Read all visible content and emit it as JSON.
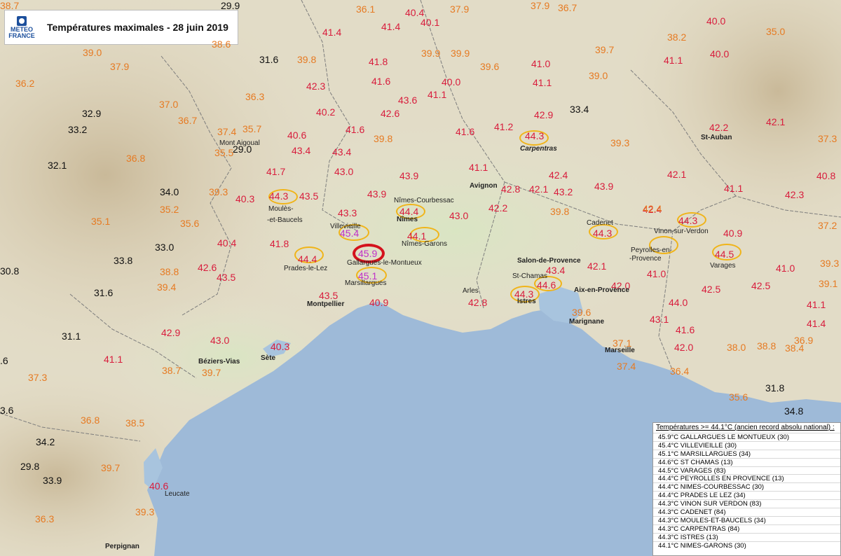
{
  "title": "Températures maximales - 28 juin 2019",
  "logo": {
    "line1": "METEO",
    "line2": "FRANCE"
  },
  "colors": {
    "black": "#111111",
    "orange": "#e67a22",
    "red": "#d81c3c",
    "magenta": "#c030c8",
    "sea": "#9ebad8",
    "ring_yellow": "#f0b418",
    "ring_red": "#d4121c"
  },
  "temperatures": [
    {
      "v": "38.7",
      "c": "orange"
    },
    {
      "v": "29.9",
      "c": "black"
    },
    {
      "v": "36.1",
      "c": "orange"
    },
    {
      "v": "40.4",
      "c": "red"
    },
    {
      "v": "37.9",
      "c": "orange"
    },
    {
      "v": "37.9",
      "c": "orange"
    },
    {
      "v": "36.7",
      "c": "orange"
    },
    {
      "v": "38.2",
      "c": "orange"
    },
    {
      "v": "40.0",
      "c": "red"
    },
    {
      "v": "35.0",
      "c": "orange"
    },
    {
      "v": "41.4",
      "c": "red"
    },
    {
      "v": "41.4",
      "c": "red"
    },
    {
      "v": "40.1",
      "c": "red"
    },
    {
      "v": "38.6",
      "c": "orange"
    },
    {
      "v": "39.0",
      "c": "orange"
    },
    {
      "v": "37.9",
      "c": "orange"
    },
    {
      "v": "31.6",
      "c": "black"
    },
    {
      "v": "39.8",
      "c": "orange"
    },
    {
      "v": "41.8",
      "c": "red"
    },
    {
      "v": "39.9",
      "c": "orange"
    },
    {
      "v": "39.9",
      "c": "orange"
    },
    {
      "v": "39.6",
      "c": "orange"
    },
    {
      "v": "41.0",
      "c": "red"
    },
    {
      "v": "39.7",
      "c": "orange"
    },
    {
      "v": "41.1",
      "c": "red"
    },
    {
      "v": "40.0",
      "c": "red"
    },
    {
      "v": "36.2",
      "c": "orange"
    },
    {
      "v": "42.3",
      "c": "red"
    },
    {
      "v": "41.6",
      "c": "red"
    },
    {
      "v": "40.0",
      "c": "red"
    },
    {
      "v": "39.0",
      "c": "orange"
    },
    {
      "v": "41.1",
      "c": "red"
    },
    {
      "v": "36.3",
      "c": "orange"
    },
    {
      "v": "43.6",
      "c": "red"
    },
    {
      "v": "41.1",
      "c": "red"
    },
    {
      "v": "37.0",
      "c": "orange"
    },
    {
      "v": "32.9",
      "c": "black"
    },
    {
      "v": "40.2",
      "c": "red"
    },
    {
      "v": "42.6",
      "c": "red"
    },
    {
      "v": "42.9",
      "c": "red"
    },
    {
      "v": "33.4",
      "c": "black"
    },
    {
      "v": "36.7",
      "c": "orange"
    },
    {
      "v": "33.2",
      "c": "black"
    },
    {
      "v": "37.4",
      "c": "orange"
    },
    {
      "v": "35.7",
      "c": "orange"
    },
    {
      "v": "40.6",
      "c": "red"
    },
    {
      "v": "41.6",
      "c": "red"
    },
    {
      "v": "41.6",
      "c": "red"
    },
    {
      "v": "41.2",
      "c": "red"
    },
    {
      "v": "42.2",
      "c": "red"
    },
    {
      "v": "42.1",
      "c": "red"
    },
    {
      "v": "39.8",
      "c": "orange"
    },
    {
      "v": "44.3",
      "c": "red"
    },
    {
      "v": "39.3",
      "c": "orange"
    },
    {
      "v": "37.3",
      "c": "orange"
    },
    {
      "v": "35.5",
      "c": "orange"
    },
    {
      "v": "29.0",
      "c": "black"
    },
    {
      "v": "43.4",
      "c": "red"
    },
    {
      "v": "43.4",
      "c": "red"
    },
    {
      "v": "36.8",
      "c": "orange"
    },
    {
      "v": "32.1",
      "c": "black"
    },
    {
      "v": "41.7",
      "c": "red"
    },
    {
      "v": "43.0",
      "c": "red"
    },
    {
      "v": "43.9",
      "c": "red"
    },
    {
      "v": "41.1",
      "c": "red"
    },
    {
      "v": "42.4",
      "c": "red"
    },
    {
      "v": "42.1",
      "c": "red"
    },
    {
      "v": "40.8",
      "c": "red"
    },
    {
      "v": "34.0",
      "c": "black"
    },
    {
      "v": "39.3",
      "c": "orange"
    },
    {
      "v": "42.8",
      "c": "red"
    },
    {
      "v": "42.1",
      "c": "red"
    },
    {
      "v": "43.2",
      "c": "red"
    },
    {
      "v": "43.9",
      "c": "red"
    },
    {
      "v": "41.1",
      "c": "red"
    },
    {
      "v": "42.3",
      "c": "red"
    },
    {
      "v": "40.3",
      "c": "red"
    },
    {
      "v": "44.3",
      "c": "red"
    },
    {
      "v": "43.5",
      "c": "red"
    },
    {
      "v": "43.9",
      "c": "red"
    },
    {
      "v": "35.2",
      "c": "orange"
    },
    {
      "v": "44.4",
      "c": "red"
    },
    {
      "v": "42.2",
      "c": "red"
    },
    {
      "v": "39.8",
      "c": "orange"
    },
    {
      "v": "42.4",
      "c": "red"
    },
    {
      "v": "43.3",
      "c": "red"
    },
    {
      "v": "43.0",
      "c": "red"
    },
    {
      "v": "35.1",
      "c": "orange"
    },
    {
      "v": "35.6",
      "c": "orange"
    },
    {
      "v": "45.4",
      "c": "magenta"
    },
    {
      "v": "44.1",
      "c": "red"
    },
    {
      "v": "44.3",
      "c": "red"
    },
    {
      "v": "44.3",
      "c": "red"
    },
    {
      "v": "37.2",
      "c": "orange"
    },
    {
      "v": "40.9",
      "c": "red"
    },
    {
      "v": "33.0",
      "c": "black"
    },
    {
      "v": "40.4",
      "c": "red"
    },
    {
      "v": "41.8",
      "c": "red"
    },
    {
      "v": "45.9",
      "c": "magenta"
    },
    {
      "v": "44.4",
      "c": "red"
    },
    {
      "v": "44.5",
      "c": "red"
    },
    {
      "v": "33.8",
      "c": "black"
    },
    {
      "v": "42.6",
      "c": "red"
    },
    {
      "v": "38.8",
      "c": "orange"
    },
    {
      "v": "43.4",
      "c": "red"
    },
    {
      "v": "42.1",
      "c": "red"
    },
    {
      "v": "41.0",
      "c": "red"
    },
    {
      "v": "39.3",
      "c": "orange"
    },
    {
      "v": "30.8",
      "c": "black"
    },
    {
      "v": "43.5",
      "c": "red"
    },
    {
      "v": "45.1",
      "c": "magenta"
    },
    {
      "v": "44.6",
      "c": "red"
    },
    {
      "v": "42.0",
      "c": "red"
    },
    {
      "v": "41.0",
      "c": "red"
    },
    {
      "v": "39.4",
      "c": "orange"
    },
    {
      "v": "31.6",
      "c": "black"
    },
    {
      "v": "43.5",
      "c": "red"
    },
    {
      "v": "42.5",
      "c": "red"
    },
    {
      "v": "42.5",
      "c": "red"
    },
    {
      "v": "39.1",
      "c": "orange"
    },
    {
      "v": "40.9",
      "c": "red"
    },
    {
      "v": "44.3",
      "c": "red"
    },
    {
      "v": "42.8",
      "c": "red"
    },
    {
      "v": "44.0",
      "c": "red"
    },
    {
      "v": "41.1",
      "c": "red"
    },
    {
      "v": "39.6",
      "c": "orange"
    },
    {
      "v": "43.1",
      "c": "red"
    },
    {
      "v": "41.4",
      "c": "red"
    },
    {
      "v": "42.9",
      "c": "red"
    },
    {
      "v": "41.6",
      "c": "red"
    },
    {
      "v": "31.1",
      "c": "black"
    },
    {
      "v": "43.0",
      "c": "red"
    },
    {
      "v": "37.1",
      "c": "orange"
    },
    {
      "v": "42.0",
      "c": "red"
    },
    {
      "v": "38.0",
      "c": "orange"
    },
    {
      "v": "38.8",
      "c": "orange"
    },
    {
      "v": "38.4",
      "c": "orange"
    },
    {
      "v": "40.3",
      "c": "red"
    },
    {
      "v": "36.9",
      "c": "orange"
    },
    {
      "v": ".6",
      "c": "black"
    },
    {
      "v": "41.1",
      "c": "red"
    },
    {
      "v": "38.7",
      "c": "orange"
    },
    {
      "v": "39.7",
      "c": "orange"
    },
    {
      "v": "37.4",
      "c": "orange"
    },
    {
      "v": "36.4",
      "c": "orange"
    },
    {
      "v": "37.3",
      "c": "orange"
    },
    {
      "v": "31.8",
      "c": "black"
    },
    {
      "v": "35.6",
      "c": "orange"
    },
    {
      "v": "34.8",
      "c": "black"
    },
    {
      "v": "3.6",
      "c": "black"
    },
    {
      "v": "36.8",
      "c": "orange"
    },
    {
      "v": "38.5",
      "c": "orange"
    },
    {
      "v": "34.2",
      "c": "black"
    },
    {
      "v": "29.8",
      "c": "black"
    },
    {
      "v": "39.7",
      "c": "orange"
    },
    {
      "v": "40.6",
      "c": "red"
    },
    {
      "v": "33.9",
      "c": "black"
    },
    {
      "v": "36.3",
      "c": "orange"
    },
    {
      "v": "39.3",
      "c": "orange"
    },
    {
      "v": "42.4",
      "c": "orange"
    }
  ],
  "places": [
    {
      "n": "Mont Aigoual",
      "b": false
    },
    {
      "n": "Carpentras",
      "b": true
    },
    {
      "n": "St-Auban",
      "b": true
    },
    {
      "n": "Avignon",
      "b": true
    },
    {
      "n": "Nîmes-Courbessac",
      "b": false
    },
    {
      "n": "Nîmes",
      "b": true
    },
    {
      "n": "Nîmes-Garons",
      "b": false
    },
    {
      "n": "Villevieille",
      "b": false
    },
    {
      "n": "Moulès-",
      "b": false
    },
    {
      "n": "-et-Baucels",
      "b": false
    },
    {
      "n": "Cadenet",
      "b": false
    },
    {
      "n": "Vinon-sur-Verdon",
      "b": false
    },
    {
      "n": "Peyrolles-en-",
      "b": false
    },
    {
      "n": "-Provence",
      "b": false
    },
    {
      "n": "Varages",
      "b": false
    },
    {
      "n": "Salon-de-Provence",
      "b": true
    },
    {
      "n": "Gallargues-le-Montueux",
      "b": false
    },
    {
      "n": "Prades-le-Lez",
      "b": false
    },
    {
      "n": "Marsillargues",
      "b": false
    },
    {
      "n": "St-Chamas",
      "b": false
    },
    {
      "n": "Aix-en-Provence",
      "b": true
    },
    {
      "n": "Arles",
      "b": false
    },
    {
      "n": "Istres",
      "b": true
    },
    {
      "n": "Montpellier",
      "b": true
    },
    {
      "n": "Marignane",
      "b": true
    },
    {
      "n": "Marseille",
      "b": true
    },
    {
      "n": "Béziers-Vias",
      "b": true
    },
    {
      "n": "Sète",
      "b": true
    },
    {
      "n": "Leucate",
      "b": false
    },
    {
      "n": "Perpignan",
      "b": true
    }
  ],
  "legend": {
    "title": "Températures >= 44.1°C (ancien record absolu national) :",
    "rows": [
      "45.9°C GALLARGUES LE MONTUEUX (30)",
      "45.4°C VILLEVIEILLE (30)",
      "45.1°C MARSILLARGUES (34)",
      "44.6°C  ST CHAMAS (13)",
      "44.5°C  VARAGES (83)",
      "44.4°C  PEYROLLES EN PROVENCE (13)",
      "44.4°C  NIMES-COURBESSAC (30)",
      "44.4°C  PRADES LE LEZ (34)",
      "44.3°C  VINON SUR VERDON (83)",
      "44.3°C  CADENET (84)",
      "44.3°C  MOULES-ET-BAUCELS (34)",
      "44.3°C  CARPENTRAS (84)",
      "44.3°C  ISTRES (13)",
      "44.1°C  NIMES-GARONS (30)"
    ]
  }
}
